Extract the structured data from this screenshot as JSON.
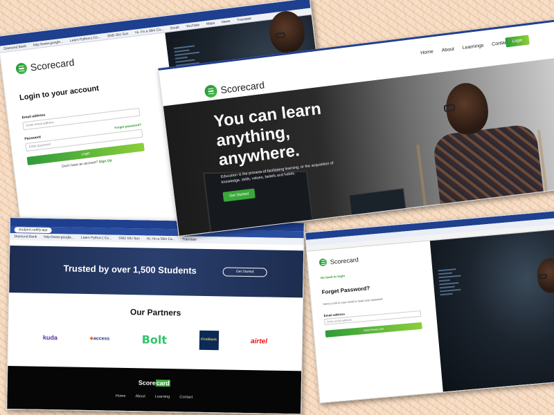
{
  "brand": {
    "name": "Scorecard",
    "accent": "#3aa83a",
    "navy": "#1f3f8f"
  },
  "login_page": {
    "browser_tabs": [
      "Diamond Bank",
      "http://www.google...",
      "Learn Python | Co...",
      "SND SIU Sun",
      "Hi, I'm a Slim Ca...",
      "Email",
      "YouTube",
      "Maps",
      "News",
      "Translate"
    ],
    "title": "Login to your account",
    "email_label": "Email address",
    "email_placeholder": "Enter email address",
    "password_label": "Password",
    "forgot_link": "Forget password?",
    "password_placeholder": "Enter password",
    "login_button": "Login",
    "no_account_text": "Don't have an account?",
    "signup_link": "Sign Up"
  },
  "hero_page": {
    "nav": [
      "Home",
      "About",
      "Learnings",
      "Contact"
    ],
    "login_button": "Login",
    "headline": [
      "You can learn",
      "anything,",
      "anywhere."
    ],
    "description": "Education is the process of facilitating learning, or the acquisition of knowledge, skills, values, beliefs and habits.",
    "cta_button": "Get Started"
  },
  "partners_page": {
    "url": "studpert.netlify.app",
    "bookmarks": [
      "Diamond Bank",
      "http://www.google...",
      "Learn Python | Co...",
      "SND SIU Sun",
      "Hi, I'm a Slim Ca...",
      "Translate"
    ],
    "trust_title": "Trusted by over 1,500 Students",
    "trust_button": "Get Started",
    "partners_title": "Our Partners",
    "partners": [
      "kuda",
      "access",
      "Bolt",
      "FirstBank",
      "airtel"
    ],
    "footer_logo_prefix": "Score",
    "footer_logo_highlight": "card",
    "footer_nav": [
      "Home",
      "About",
      "Learning",
      "Contact"
    ]
  },
  "forgot_page": {
    "back_link": "Go back to login",
    "title": "Forget Password?",
    "subtitle": "Send a Link to your email to reset your password",
    "email_label": "Email address",
    "email_placeholder": "Enter email address",
    "submit_button": "Send Reset Link"
  }
}
